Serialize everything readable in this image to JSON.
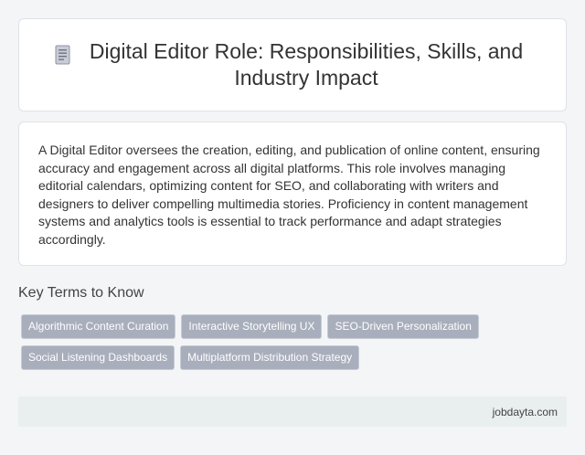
{
  "header": {
    "icon": "document-icon",
    "title": "Digital Editor Role: Responsibilities, Skills, and Industry Impact"
  },
  "description": "A Digital Editor oversees the creation, editing, and publication of online content, ensuring accuracy and engagement across all digital platforms. This role involves managing editorial calendars, optimizing content for SEO, and collaborating with writers and designers to deliver compelling multimedia stories. Proficiency in content management systems and analytics tools is essential to track performance and adapt strategies accordingly.",
  "key_terms": {
    "heading": "Key Terms to Know",
    "tags": [
      "Algorithmic Content Curation",
      "Interactive Storytelling UX",
      "SEO-Driven Personalization",
      "Social Listening Dashboards",
      "Multiplatform Distribution Strategy"
    ]
  },
  "footer": {
    "site": "jobdayta.com"
  },
  "colors": {
    "tag_bg": "#a9aebc",
    "page_bg": "#f3f5f7",
    "footer_bg": "#e9eeee"
  }
}
